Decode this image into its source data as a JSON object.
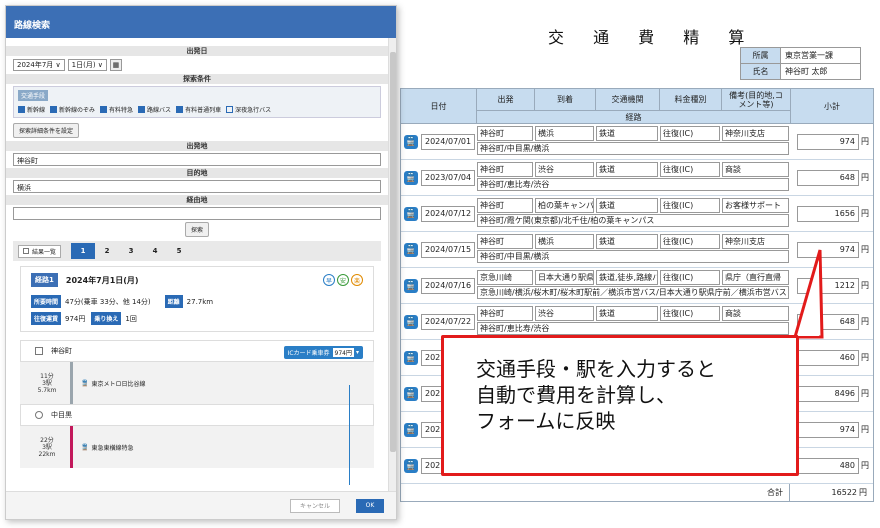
{
  "sheet": {
    "title": "交 通 費 精 算",
    "info": [
      {
        "label": "所属",
        "value": "東京営業一課"
      },
      {
        "label": "氏名",
        "value": "神谷町 太郎"
      }
    ],
    "headers": {
      "date": "日付",
      "from": "出発",
      "to": "到着",
      "transport": "交通機関",
      "fare_type": "料金種別",
      "note": "備考(目的地,コメント等)",
      "route": "経路",
      "subtotal": "小計"
    },
    "rows": [
      {
        "date": "2024/07/01",
        "from": "神谷町",
        "to": "横浜",
        "transport": "鉄道",
        "fare_type": "往復(IC)",
        "note": "神奈川支店",
        "route": "神谷町/中目黒/横浜",
        "subtotal": "974"
      },
      {
        "date": "2023/07/04",
        "from": "神谷町",
        "to": "渋谷",
        "transport": "鉄道",
        "fare_type": "往復(IC)",
        "note": "商談",
        "route": "神谷町/恵比寿/渋谷",
        "subtotal": "648"
      },
      {
        "date": "2024/07/12",
        "from": "神谷町",
        "to": "柏の葉キャンパ",
        "transport": "鉄道",
        "fare_type": "往復(IC)",
        "note": "お客様サポート",
        "route": "神谷町/霞ケ関(東京都)/北千住/柏の葉キャンパス",
        "subtotal": "1656"
      },
      {
        "date": "2024/07/15",
        "from": "神谷町",
        "to": "横浜",
        "transport": "鉄道",
        "fare_type": "往復(IC)",
        "note": "神奈川支店",
        "route": "神谷町/中目黒/横浜",
        "subtotal": "974"
      },
      {
        "date": "2024/07/16",
        "from": "京急川崎",
        "to": "日本大通り駅県",
        "transport": "鉄道,徒歩,路線バ",
        "fare_type": "往復(IC)",
        "note": "県庁（直行直帰",
        "route": "京急川崎/横浜/桜木町/桜木町駅前／横浜市営バス/日本大通り駅県庁前／横浜市営バス",
        "subtotal": "1212"
      },
      {
        "date": "2024/07/22",
        "from": "神谷町",
        "to": "渋谷",
        "transport": "鉄道",
        "fare_type": "往復(IC)",
        "note": "商談",
        "route": "神谷町/恵比寿/渋谷",
        "subtotal": "648"
      },
      {
        "date": "202",
        "subtotal": "460"
      },
      {
        "date": "202",
        "subtotal": "8496"
      },
      {
        "date": "202",
        "subtotal": "974"
      },
      {
        "date": "202",
        "subtotal": "480"
      }
    ],
    "yen": "円",
    "total_label": "合計",
    "total_value": "16522",
    "train_icon": "train-icon"
  },
  "callout": {
    "lines": [
      "交通手段・駅を入力すると",
      "自動で費用を計算し、",
      "フォームに反映"
    ]
  },
  "dialog": {
    "title": "路線検索",
    "departure_date_header": "出発日",
    "year_month": "2024年7月",
    "day": "1日(月)",
    "cond_header": "探索条件",
    "transport_label": "交通手段",
    "checks": [
      {
        "label": "新幹線",
        "on": true
      },
      {
        "label": "新幹線のぞみ",
        "on": true
      },
      {
        "label": "有料特急",
        "on": true
      },
      {
        "label": "路線バス",
        "on": true
      },
      {
        "label": "有料普通列車",
        "on": true
      },
      {
        "label": "深夜急行バス",
        "on": false
      }
    ],
    "detail_button": "探索詳細条件を設定",
    "from_header": "出発地",
    "from_value": "神谷町",
    "to_header": "目的地",
    "to_value": "横浜",
    "via_header": "経由地",
    "via_value": "",
    "search_button": "探索",
    "list_button": "結果一覧",
    "tabs": [
      "1",
      "2",
      "3",
      "4",
      "5"
    ],
    "result": {
      "badge": "経路1",
      "date": "2024年7月1日(月)",
      "icons": [
        "早",
        "安",
        "楽"
      ],
      "time_tag": "所要時間",
      "time_value": "47分(乗車 33分、他 14分)",
      "dist_tag": "距離",
      "dist_value": "27.7km",
      "fare_tag": "往復運賃",
      "fare_value": "974円",
      "transfer_tag": "乗り換え",
      "transfer_value": "1回"
    },
    "steps": {
      "start": "神谷町",
      "ic_label": "ICカード乗車券",
      "ic_fare": "974円",
      "leg1_info": [
        "11分",
        "3駅",
        "5.7km"
      ],
      "leg1_line": "東京メトロ日比谷線",
      "mid": "中目黒",
      "leg2_info": [
        "22分",
        "3駅",
        "22km"
      ],
      "leg2_line": "東急東横線特急"
    },
    "cancel_button": "キャンセル",
    "ok_button": "OK"
  }
}
